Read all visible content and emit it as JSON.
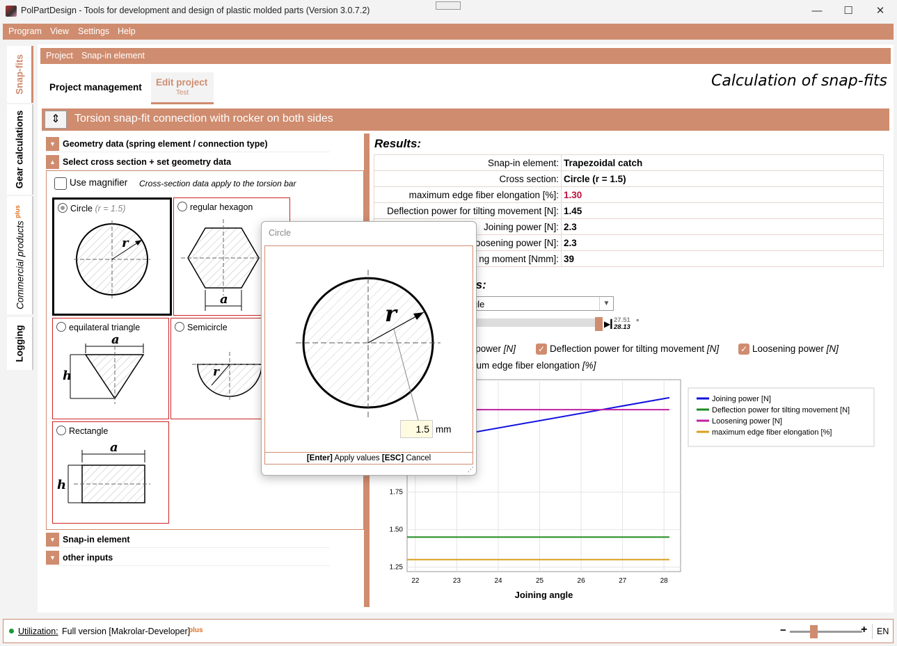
{
  "window": {
    "title": "PolPartDesign - Tools for development and design of plastic molded parts (Version 3.0.7.2)",
    "minimize": "—",
    "maximize": "☐",
    "close": "✕"
  },
  "menu": [
    "Program",
    "View",
    "Settings",
    "Help"
  ],
  "side_tabs": {
    "snapfits": "Snap-fits",
    "gear": "Gear calculations",
    "commercial": "Commercial products",
    "commercial_plus": "plus",
    "logging": "Logging"
  },
  "breadcrumb": [
    "Project",
    "Snap-in element"
  ],
  "tabs": {
    "project_management": "Project management",
    "edit_project": "Edit project",
    "edit_project_sub": "Test"
  },
  "heading": "Calculation of snap-fits",
  "section_title": "Torsion snap-fit connection with rocker on both sides",
  "accordion": {
    "geometry": "Geometry data (spring element / connection type)",
    "cross_section": "Select cross section + set geometry data",
    "snap_in": "Snap-in element",
    "other": "other inputs"
  },
  "magnifier": {
    "label": "Use magnifier",
    "note": "Cross-section data apply to the torsion bar"
  },
  "shapes": {
    "circle": "Circle",
    "circle_param": "(r = 1.5)",
    "hexagon": "regular hexagon",
    "triangle": "equilateral triangle",
    "semicircle": "Semicircle",
    "rectangle": "Rectangle",
    "r": "r",
    "a": "a",
    "h": "h"
  },
  "results": {
    "title": "Results:",
    "rows": [
      {
        "key": "Snap-in element:",
        "value": "Trapezoidal catch"
      },
      {
        "key": "Cross section:",
        "value": "Circle (r = 1.5)"
      },
      {
        "key": "maximum edge fiber elongation [%]:",
        "value": "1.30"
      },
      {
        "key": "Deflection power for tilting movement [N]:",
        "value": "1.45"
      },
      {
        "key": "Joining power [N]:",
        "value": "2.3"
      },
      {
        "key": "Loosening power [N]:",
        "value": "2.3"
      },
      {
        "key": "ng moment [Nmm]:",
        "value": "39"
      }
    ],
    "red_color": "#c0103a"
  },
  "graph_controls": {
    "section_title_fragment": "ts:",
    "dropdown_value": "gle",
    "slider_value_top": "27.51",
    "slider_value_bottom": "28.13",
    "degree": "°",
    "check_joining": "g power",
    "check_joining_unit": "[N]",
    "check_deflection": "Deflection power for tilting movement",
    "check_deflection_unit": "[N]",
    "check_loosening": "Loosening power",
    "check_loosening_unit": "[N]",
    "check_elongation": "num edge fiber elongation",
    "check_elongation_unit": "[%]"
  },
  "chart_data": {
    "type": "line",
    "xlabel": "Joining angle",
    "ylabel": "",
    "x_ticks": [
      "22",
      "23",
      "24",
      "25",
      "26",
      "27",
      "28"
    ],
    "y_ticks": [
      "1.25",
      "1.50",
      "1.75"
    ],
    "xlim": [
      21.8,
      28.4
    ],
    "ylim": [
      1.22,
      2.5
    ],
    "legend_position": "top-right",
    "series": [
      {
        "name": "Joining power [N]",
        "color": "#1010e0",
        "x": [
          21.8,
          28.13
        ],
        "y": [
          2.07,
          2.38
        ]
      },
      {
        "name": "Deflection power for tilting movement [N]",
        "color": "#1e8a1e",
        "x": [
          21.8,
          28.13
        ],
        "y": [
          1.45,
          1.45
        ]
      },
      {
        "name": "Loosening power [N]",
        "color": "#c020a0",
        "x": [
          21.8,
          28.13
        ],
        "y": [
          2.3,
          2.3
        ]
      },
      {
        "name": "maximum edge fiber elongation [%]",
        "color": "#d8a020",
        "x": [
          21.8,
          28.13
        ],
        "y": [
          1.3,
          1.3
        ]
      }
    ]
  },
  "popup": {
    "title": "Circle",
    "r_label": "r",
    "value": "1.5",
    "unit": "mm",
    "enter_key": "[Enter]",
    "apply": "Apply values",
    "esc_key": "[ESC]",
    "cancel": "Cancel"
  },
  "status": {
    "utilization_label": "Utilization:",
    "version": "Full version [Makrolar-Developer]",
    "plus": "plus",
    "zoom_minus": "−",
    "zoom_plus": "+",
    "language": "EN"
  },
  "colors": {
    "accent": "#cf8c6f",
    "shape_border": "#cc2222"
  }
}
